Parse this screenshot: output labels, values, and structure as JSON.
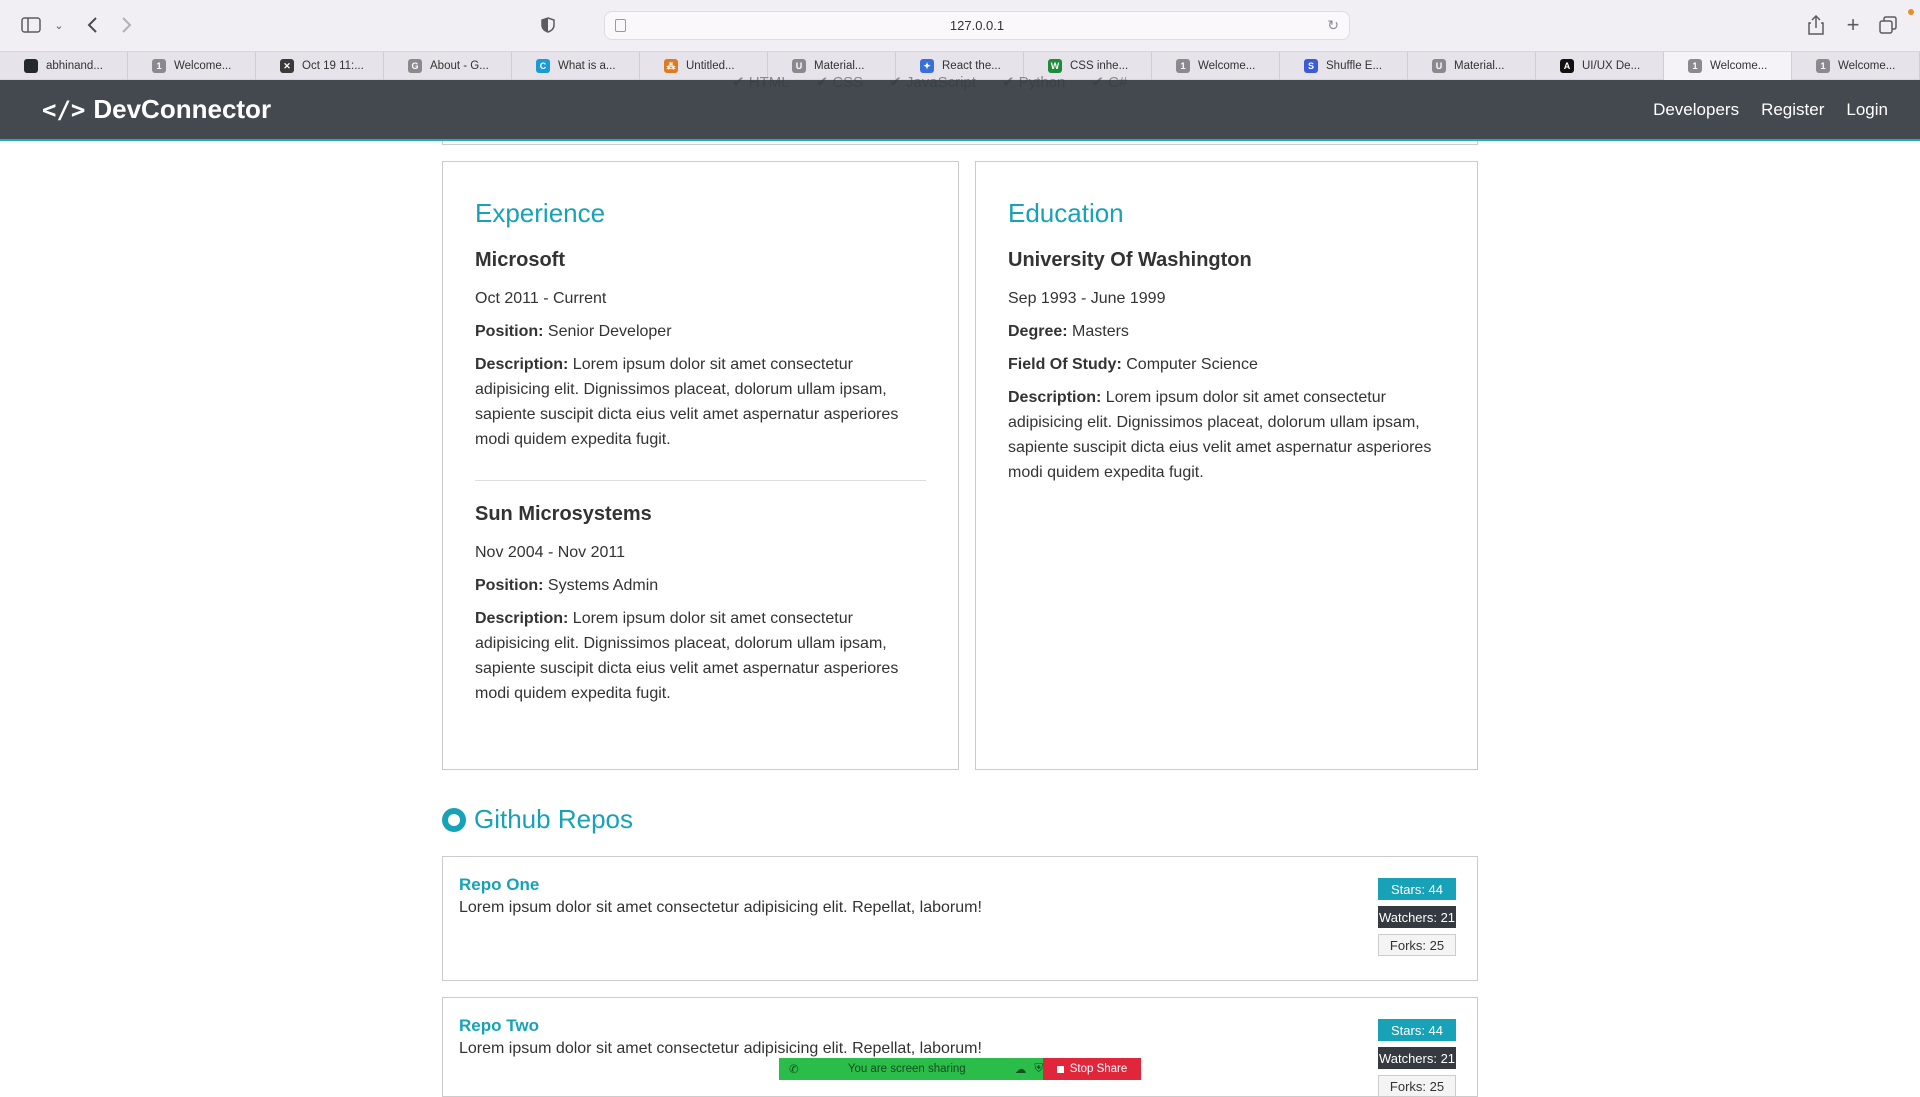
{
  "browser": {
    "url": "127.0.0.1",
    "tabs": [
      {
        "label": "abhinand...",
        "fav_color": "#24292e",
        "fav_char": ""
      },
      {
        "label": "Welcome...",
        "fav_color": "#8a8a8e",
        "fav_char": "1"
      },
      {
        "label": "Oct 19 11:...",
        "fav_color": "#3a3a3a",
        "fav_char": "✕"
      },
      {
        "label": "About - G...",
        "fav_color": "#8a8a8e",
        "fav_char": "G"
      },
      {
        "label": "What is a...",
        "fav_color": "#1a9ad6",
        "fav_char": "C"
      },
      {
        "label": "Untitled...",
        "fav_color": "#e07a1f",
        "fav_char": "⁂"
      },
      {
        "label": "Material...",
        "fav_color": "#8a8a8e",
        "fav_char": "U"
      },
      {
        "label": "React the...",
        "fav_color": "#3b6fd8",
        "fav_char": "✦"
      },
      {
        "label": "CSS inhe...",
        "fav_color": "#1f8a3b",
        "fav_char": "W"
      },
      {
        "label": "Welcome...",
        "fav_color": "#8a8a8e",
        "fav_char": "1"
      },
      {
        "label": "Shuffle E...",
        "fav_color": "#3b5bd8",
        "fav_char": "S"
      },
      {
        "label": "Material...",
        "fav_color": "#8a8a8e",
        "fav_char": "U"
      },
      {
        "label": "UI/UX De...",
        "fav_color": "#111111",
        "fav_char": "A"
      },
      {
        "label": "Welcome...",
        "fav_color": "#8a8a8e",
        "fav_char": "1"
      },
      {
        "label": "Welcome...",
        "fav_color": "#8a8a8e",
        "fav_char": "1"
      }
    ],
    "active_tab_index": 13
  },
  "navbar": {
    "brand": "DevConnector",
    "brand_icon": "</>",
    "links": [
      "Developers",
      "Register",
      "Login"
    ]
  },
  "skills_behind": [
    "✔ HTML",
    "✔ CSS",
    "✔ JavaScript",
    "✔ Python",
    "✔ C#"
  ],
  "experience": {
    "title": "Experience",
    "items": [
      {
        "company": "Microsoft",
        "dates": "Oct 2011 - Current",
        "position_label": "Position:",
        "position": "Senior Developer",
        "description_label": "Description:",
        "description": "Lorem ipsum dolor sit amet consectetur adipisicing elit. Dignissimos placeat, dolorum ullam ipsam, sapiente suscipit dicta eius velit amet aspernatur asperiores modi quidem expedita fugit."
      },
      {
        "company": "Sun Microsystems",
        "dates": "Nov 2004 - Nov 2011",
        "position_label": "Position:",
        "position": "Systems Admin",
        "description_label": "Description:",
        "description": "Lorem ipsum dolor sit amet consectetur adipisicing elit. Dignissimos placeat, dolorum ullam ipsam, sapiente suscipit dicta eius velit amet aspernatur asperiores modi quidem expedita fugit."
      }
    ]
  },
  "education": {
    "title": "Education",
    "school": "University Of Washington",
    "dates": "Sep 1993 - June 1999",
    "degree_label": "Degree:",
    "degree": "Masters",
    "field_label": "Field Of Study:",
    "field": "Computer Science",
    "description_label": "Description:",
    "description": "Lorem ipsum dolor sit amet consectetur adipisicing elit. Dignissimos placeat, dolorum ullam ipsam, sapiente suscipit dicta eius velit amet aspernatur asperiores modi quidem expedita fugit."
  },
  "repos": {
    "title": "Github Repos",
    "items": [
      {
        "name": "Repo One",
        "description": "Lorem ipsum dolor sit amet consectetur adipisicing elit. Repellat, laborum!",
        "stars": "Stars: 44",
        "watchers": "Watchers: 21",
        "forks": "Forks: 25"
      },
      {
        "name": "Repo Two",
        "description": "Lorem ipsum dolor sit amet consectetur adipisicing elit. Repellat, laborum!",
        "stars": "Stars: 44",
        "watchers": "Watchers: 21",
        "forks": "Forks: 25"
      }
    ]
  },
  "screen_share": {
    "status": "You are screen sharing",
    "stop_label": "Stop Share"
  },
  "colors": {
    "accent": "#17a2b8",
    "navbar": "#343a40",
    "share_green": "#2bbd4a",
    "share_red": "#e0263a"
  }
}
